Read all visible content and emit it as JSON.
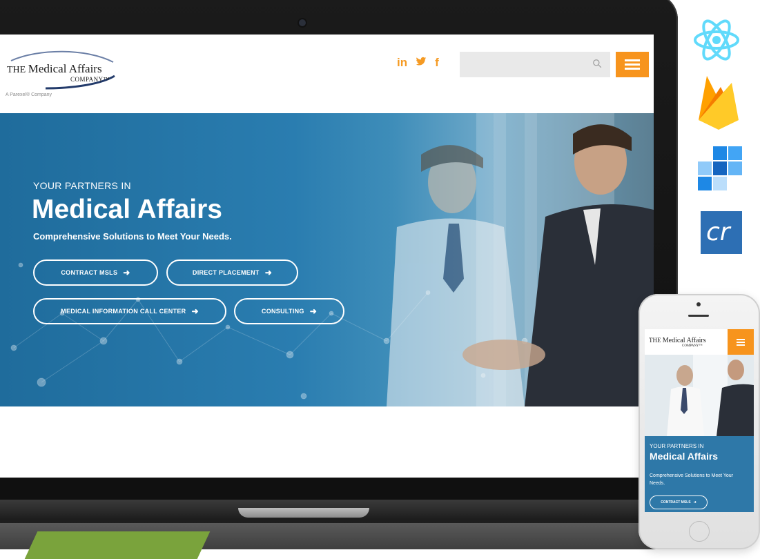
{
  "site": {
    "logo": {
      "line1_prefix": "THE",
      "line1_name": "Medical Affairs",
      "line2": "COMPANY™",
      "tagline": "A Parexel® Company"
    },
    "social": {
      "linkedin": "in",
      "twitter_icon": "twitter-icon",
      "facebook": "f"
    },
    "search": {
      "placeholder": ""
    },
    "hero": {
      "kicker": "YOUR PARTNERS IN",
      "title": "Medical Affairs",
      "subtitle": "Comprehensive Solutions to Meet Your Needs.",
      "buttons": [
        {
          "label": "CONTRACT MSLS"
        },
        {
          "label": "DIRECT PLACEMENT"
        },
        {
          "label": "MEDICAL INFORMATION CALL CENTER"
        },
        {
          "label": "CONSULTING"
        }
      ]
    }
  },
  "phone": {
    "logo": {
      "line1_prefix": "THE",
      "line1_name": "Medical Affairs",
      "line2": "COMPANY™"
    },
    "hero": {
      "kicker": "YOUR PARTNERS IN",
      "title": "Medical Affairs",
      "subtitle": "Comprehensive Solutions to Meet Your Needs.",
      "button": "CONTRACT MSLS"
    }
  },
  "tech_icons": [
    "react-icon",
    "firebase-icon",
    "squares-icon",
    "cr-icon"
  ],
  "tech_cr_text": "cr",
  "colors": {
    "accent_orange": "#f7941d",
    "hero_blue": "#2a7db0",
    "react_blue": "#61dafb",
    "firebase_yellow": "#ffca28"
  }
}
